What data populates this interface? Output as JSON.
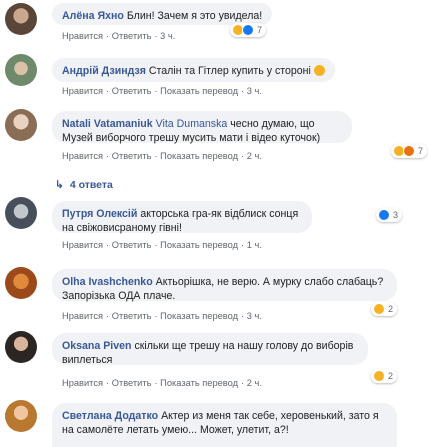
{
  "comments": [
    {
      "author": "Алёна Яхно",
      "text": "Блин! Зачем я это увидела!",
      "actions": [
        "Нравится",
        "Ответить",
        "3 ч."
      ],
      "reaction_count": "7"
    },
    {
      "author": "Андрій Дзиндзя",
      "text": "Сталін та Гітлер купить у сторонi",
      "actions": [
        "Нравится",
        "Ответить",
        "Показать перевод",
        "3 ч."
      ]
    },
    {
      "author": "Natali Vatamaniuk",
      "mention": "Vita Dumanska",
      "text": "чесно думаю, що Музей виборчого трешу мусить мати і відео куточок)",
      "actions": [
        "Нравится",
        "Ответить",
        "Показать перевод",
        "2 ч."
      ],
      "reaction_count": "7",
      "replies_label": "4 ответа"
    },
    {
      "author": "Путря Олексій",
      "text": "акторська гра-як відблиск сонця на свіжовисраному гівні!",
      "actions": [
        "Нравится",
        "Ответить",
        "Показать перевод",
        "1 ч."
      ],
      "reaction_count": "3"
    },
    {
      "author": "Olha Ivashchenko",
      "text": "Актьорішка, не верю. А мурку слабо слабаць? Запорізька ОДА плаче.",
      "actions": [
        "Нравится",
        "Ответить",
        "Показать перевод",
        "3 ч."
      ],
      "reaction_count": "2"
    },
    {
      "author": "Oksana Piven",
      "text": "скільки ще трешу на нашу голову до виборів виплеться",
      "actions": [
        "Нравится",
        "Ответить",
        "Показать перевод",
        "2 ч."
      ],
      "reaction_count": "2"
    },
    {
      "author": "Светлана Додатко",
      "text": "Актер из меня так себе, херовенький, зато я на самолёте летать умею... Может, улетит, а?!"
    }
  ],
  "colors": {
    "link": "#385898",
    "bubble": "#f0f2f5",
    "meta": "#606770"
  }
}
